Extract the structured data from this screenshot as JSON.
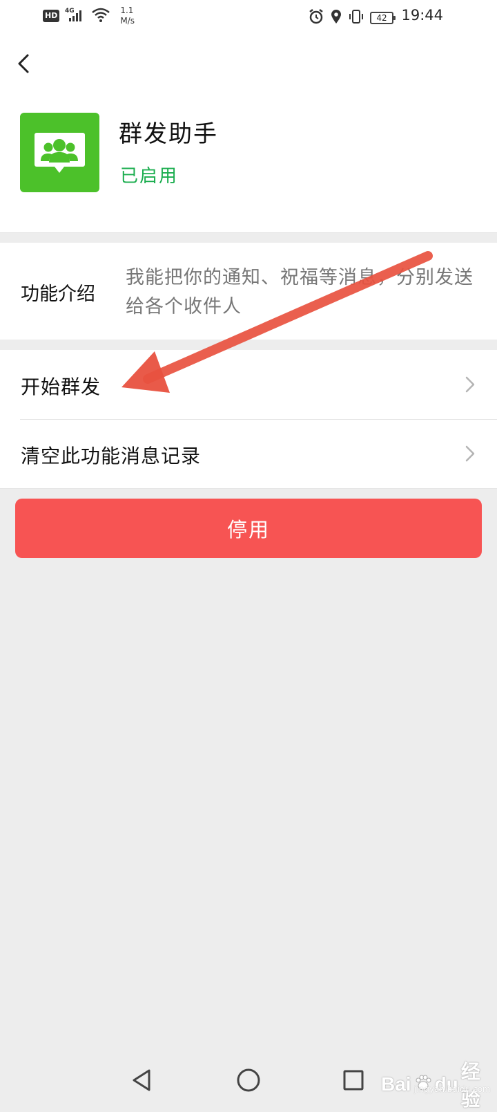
{
  "status_bar": {
    "hd": "HD",
    "network": "4G",
    "speed_value": "1.1",
    "speed_unit": "M/s",
    "battery": "42",
    "time": "19:44"
  },
  "header": {
    "app_name": "群发助手",
    "app_status": "已启用"
  },
  "intro": {
    "label": "功能介绍",
    "text": "我能把你的通知、祝福等消息，分别发送给各个收件人"
  },
  "menu": [
    {
      "label": "开始群发"
    },
    {
      "label": "清空此功能消息记录"
    }
  ],
  "disable_button": {
    "label": "停用"
  },
  "watermark": {
    "brand": "Bai",
    "brand2": "du",
    "suffix": "经验",
    "url": "jingyan.baidu.com"
  },
  "colors": {
    "accent_green": "#4cc12a",
    "status_green": "#1aad4e",
    "danger_red": "#f75453",
    "annotation_arrow": "#e8513f"
  }
}
